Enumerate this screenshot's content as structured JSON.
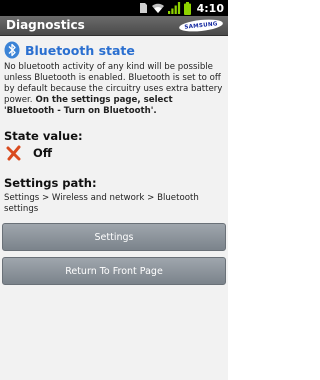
{
  "status_bar": {
    "time": "4:10",
    "icons": [
      "sim-card-icon",
      "wifi-icon",
      "signal-icon",
      "battery-icon"
    ]
  },
  "app": {
    "title": "Diagnostics",
    "brand": "SAMSUNG"
  },
  "section": {
    "icon": "bluetooth-icon",
    "title": "Bluetooth state",
    "description_plain": "No bluetooth activity of any kind will be possible unless Bluetooth is enabled. Bluetooth is set to off by default because the circuitry uses extra battery power.",
    "description_bold": " On the settings page, select 'Bluetooth - Turn on Bluetooth'."
  },
  "state": {
    "label": "State value:",
    "icon": "cross-icon",
    "value": "Off"
  },
  "settings_path": {
    "label": "Settings path:",
    "value": "Settings > Wireless and network > Bluetooth settings"
  },
  "buttons": {
    "settings": "Settings",
    "front_page": "Return To Front Page"
  },
  "colors": {
    "accent_title": "#2a6fd0",
    "title_bar": "#5a5a5a",
    "button": "#8c939a",
    "cross": "#d94a1e"
  }
}
